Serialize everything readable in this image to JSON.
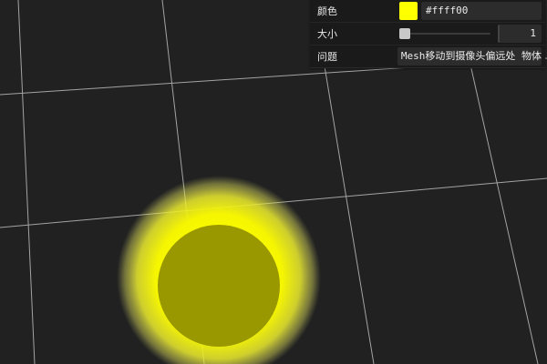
{
  "scene": {
    "background": "#212121",
    "grid_color": "#d0d0d0",
    "sphere_color": "#9a9800",
    "glow_color": "#ffff00"
  },
  "gui": {
    "color_row": {
      "label": "颜色",
      "value": "#ffff00",
      "swatch": "#ffff00"
    },
    "size_row": {
      "label": "大小",
      "value": "1",
      "level": 0.0
    },
    "issue_row": {
      "label": "问题",
      "value": "Mesh移动到摄像头偏远处 物体"
    }
  }
}
